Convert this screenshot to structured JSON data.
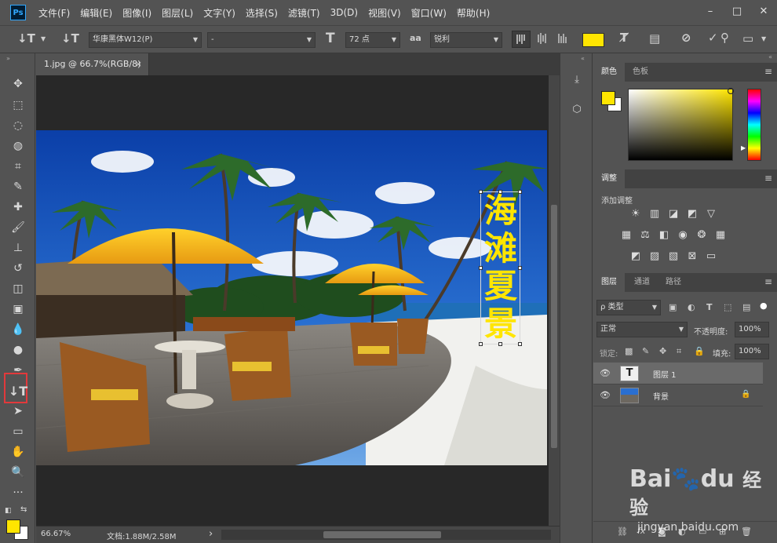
{
  "app": {
    "logo": "Ps",
    "menu": [
      "文件(F)",
      "编辑(E)",
      "图像(I)",
      "图层(L)",
      "文字(Y)",
      "选择(S)",
      "滤镜(T)",
      "3D(D)",
      "视图(V)",
      "窗口(W)",
      "帮助(H)"
    ],
    "window_controls": {
      "minimize": "–",
      "restore": "□",
      "close": "✕"
    }
  },
  "options": {
    "tool_preset_icon": "↓T",
    "orientation_icon": "↓T",
    "font_family": "华康黑体W12(P)",
    "font_style": "-",
    "size_icon": "T",
    "font_size": "72 点",
    "aa_icon": "aa",
    "anti_alias": "锐利",
    "text_color": "#ffe500"
  },
  "document": {
    "tab_title": "1.jpg @ 66.7%(RGB/8)",
    "tab_close": "×",
    "vertical_text": [
      "海",
      "滩",
      "夏",
      "景"
    ],
    "text_color": "#ffe500"
  },
  "status": {
    "zoom": "66.67%",
    "doc_info": "文档:1.88M/2.58M",
    "arrow": "›"
  },
  "colors": {
    "foreground": "#ffe500",
    "background": "#ffffff"
  },
  "color_panel": {
    "tabs": [
      "颜色",
      "色板"
    ]
  },
  "adjustments_panel": {
    "tab": "调整",
    "add_label": "添加调整"
  },
  "layers_panel": {
    "tabs": [
      "图层",
      "通道",
      "路径"
    ],
    "filter_label": "ρ 类型",
    "blend_mode": "正常",
    "opacity_label": "不透明度:",
    "opacity_value": "100%",
    "lock_label": "锁定:",
    "fill_label": "填充:",
    "fill_value": "100%",
    "layers": [
      {
        "name": "图层 1",
        "thumb": "T",
        "selected": true
      },
      {
        "name": "背景",
        "locked": true,
        "selected": false
      }
    ]
  },
  "watermark": {
    "brand": "Bai",
    "brand2": "du",
    "cn": "经验",
    "url": "jingyan.baidu.com"
  }
}
